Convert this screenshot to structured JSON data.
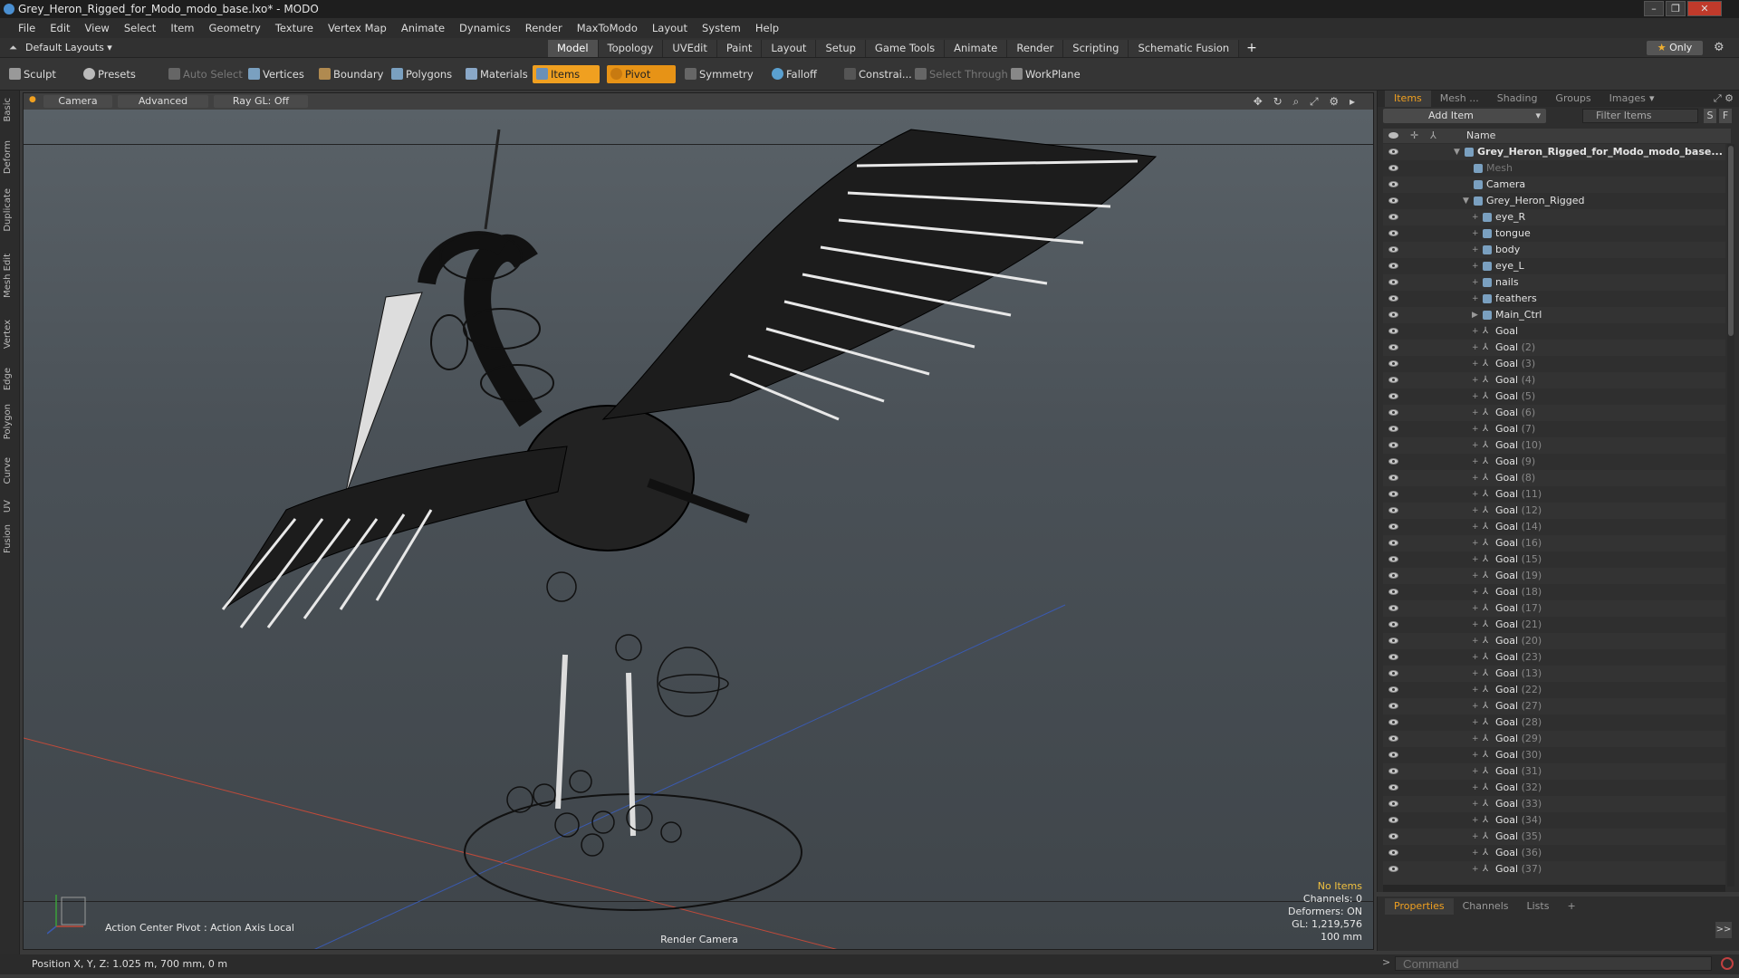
{
  "window": {
    "title": "Grey_Heron_Rigged_for_Modo_modo_base.lxo* - MODO",
    "min": "–",
    "max": "❐",
    "close": "✕"
  },
  "menu": [
    "File",
    "Edit",
    "View",
    "Select",
    "Item",
    "Geometry",
    "Texture",
    "Vertex Map",
    "Animate",
    "Dynamics",
    "Render",
    "MaxToModo",
    "Layout",
    "System",
    "Help"
  ],
  "layout_selector": "Default Layouts ▾",
  "layout_tabs": [
    "Model",
    "Topology",
    "UVEdit",
    "Paint",
    "Layout",
    "Setup",
    "Game Tools",
    "Animate",
    "Render",
    "Scripting",
    "Schematic Fusion"
  ],
  "active_layout_tab": "Model",
  "add_tab": "+",
  "only_button": {
    "star": "★",
    "label": "Only"
  },
  "toolbar": {
    "sculpt": "Sculpt",
    "presets": "Presets",
    "auto_select": "Auto Select",
    "vertices": "Vertices",
    "boundary": "Boundary",
    "polygons": "Polygons",
    "materials": "Materials",
    "items": "Items",
    "pivot": "Pivot",
    "symmetry": "Symmetry",
    "falloff": "Falloff",
    "constraints": "Constrai...",
    "select_through": "Select Through",
    "workplane": "WorkPlane"
  },
  "left_tabs": [
    "Basic",
    "Deform",
    "Duplicate",
    "Mesh Edit",
    "Vertex",
    "Edge",
    "Polygon",
    "Curve",
    "UV",
    "Fusion"
  ],
  "viewport": {
    "camera": "Camera",
    "advanced": "Advanced",
    "raygl": "Ray GL: Off",
    "icons": "✥ ↻ ⌕ ⤢ ⚙ ▸",
    "stats": {
      "no_items": "No Items",
      "channels": "Channels: 0",
      "deformers": "Deformers: ON",
      "gl": "GL: 1,219,576",
      "scale": "100 mm"
    },
    "action_center": "Action Center Pivot : Action Axis Local",
    "render_camera": "Render Camera"
  },
  "status": "Position X, Y, Z:   1.025 m, 700 mm, 0 m",
  "right_panel": {
    "tabs": [
      "Items",
      "Mesh ...",
      "Shading",
      "Groups",
      "Images"
    ],
    "active_tab": "Items",
    "more": "▾",
    "icons": "⤢ ⚙",
    "add_item": "Add Item",
    "add_item_arrow": "▾",
    "filter_items": "Filter Items",
    "s": "S",
    "f": "F",
    "name_header": "Name",
    "rows": [
      {
        "name": "Grey_Heron_Rigged_for_Modo_modo_base...",
        "num": "",
        "indent": 0,
        "bold": true,
        "dim": false,
        "toggle": "▼"
      },
      {
        "name": "Mesh",
        "num": "",
        "indent": 1,
        "bold": false,
        "dim": true,
        "toggle": ""
      },
      {
        "name": "Camera",
        "num": "",
        "indent": 1,
        "bold": false,
        "dim": false,
        "toggle": ""
      },
      {
        "name": "Grey_Heron_Rigged",
        "num": "",
        "indent": 1,
        "bold": false,
        "dim": false,
        "toggle": "▼"
      },
      {
        "name": "eye_R",
        "num": "",
        "indent": 2,
        "bold": false,
        "dim": false,
        "toggle": "+"
      },
      {
        "name": "tongue",
        "num": "",
        "indent": 2,
        "bold": false,
        "dim": false,
        "toggle": "+"
      },
      {
        "name": "body",
        "num": "",
        "indent": 2,
        "bold": false,
        "dim": false,
        "toggle": "+"
      },
      {
        "name": "eye_L",
        "num": "",
        "indent": 2,
        "bold": false,
        "dim": false,
        "toggle": "+"
      },
      {
        "name": "nails",
        "num": "",
        "indent": 2,
        "bold": false,
        "dim": false,
        "toggle": "+"
      },
      {
        "name": "feathers",
        "num": "",
        "indent": 2,
        "bold": false,
        "dim": false,
        "toggle": "+"
      },
      {
        "name": "Main_Ctrl",
        "num": "",
        "indent": 2,
        "bold": false,
        "dim": false,
        "toggle": "▶"
      },
      {
        "name": "Goal",
        "num": "",
        "indent": 2,
        "bold": false,
        "dim": false,
        "toggle": "+",
        "loc": true
      },
      {
        "name": "Goal",
        "num": "(2)",
        "indent": 2,
        "bold": false,
        "dim": false,
        "toggle": "+",
        "loc": true
      },
      {
        "name": "Goal",
        "num": "(3)",
        "indent": 2,
        "bold": false,
        "dim": false,
        "toggle": "+",
        "loc": true
      },
      {
        "name": "Goal",
        "num": "(4)",
        "indent": 2,
        "bold": false,
        "dim": false,
        "toggle": "+",
        "loc": true
      },
      {
        "name": "Goal",
        "num": "(5)",
        "indent": 2,
        "bold": false,
        "dim": false,
        "toggle": "+",
        "loc": true
      },
      {
        "name": "Goal",
        "num": "(6)",
        "indent": 2,
        "bold": false,
        "dim": false,
        "toggle": "+",
        "loc": true
      },
      {
        "name": "Goal",
        "num": "(7)",
        "indent": 2,
        "bold": false,
        "dim": false,
        "toggle": "+",
        "loc": true
      },
      {
        "name": "Goal",
        "num": "(10)",
        "indent": 2,
        "bold": false,
        "dim": false,
        "toggle": "+",
        "loc": true
      },
      {
        "name": "Goal",
        "num": "(9)",
        "indent": 2,
        "bold": false,
        "dim": false,
        "toggle": "+",
        "loc": true
      },
      {
        "name": "Goal",
        "num": "(8)",
        "indent": 2,
        "bold": false,
        "dim": false,
        "toggle": "+",
        "loc": true
      },
      {
        "name": "Goal",
        "num": "(11)",
        "indent": 2,
        "bold": false,
        "dim": false,
        "toggle": "+",
        "loc": true
      },
      {
        "name": "Goal",
        "num": "(12)",
        "indent": 2,
        "bold": false,
        "dim": false,
        "toggle": "+",
        "loc": true
      },
      {
        "name": "Goal",
        "num": "(14)",
        "indent": 2,
        "bold": false,
        "dim": false,
        "toggle": "+",
        "loc": true
      },
      {
        "name": "Goal",
        "num": "(16)",
        "indent": 2,
        "bold": false,
        "dim": false,
        "toggle": "+",
        "loc": true
      },
      {
        "name": "Goal",
        "num": "(15)",
        "indent": 2,
        "bold": false,
        "dim": false,
        "toggle": "+",
        "loc": true
      },
      {
        "name": "Goal",
        "num": "(19)",
        "indent": 2,
        "bold": false,
        "dim": false,
        "toggle": "+",
        "loc": true
      },
      {
        "name": "Goal",
        "num": "(18)",
        "indent": 2,
        "bold": false,
        "dim": false,
        "toggle": "+",
        "loc": true
      },
      {
        "name": "Goal",
        "num": "(17)",
        "indent": 2,
        "bold": false,
        "dim": false,
        "toggle": "+",
        "loc": true
      },
      {
        "name": "Goal",
        "num": "(21)",
        "indent": 2,
        "bold": false,
        "dim": false,
        "toggle": "+",
        "loc": true
      },
      {
        "name": "Goal",
        "num": "(20)",
        "indent": 2,
        "bold": false,
        "dim": false,
        "toggle": "+",
        "loc": true
      },
      {
        "name": "Goal",
        "num": "(23)",
        "indent": 2,
        "bold": false,
        "dim": false,
        "toggle": "+",
        "loc": true
      },
      {
        "name": "Goal",
        "num": "(13)",
        "indent": 2,
        "bold": false,
        "dim": false,
        "toggle": "+",
        "loc": true
      },
      {
        "name": "Goal",
        "num": "(22)",
        "indent": 2,
        "bold": false,
        "dim": false,
        "toggle": "+",
        "loc": true
      },
      {
        "name": "Goal",
        "num": "(27)",
        "indent": 2,
        "bold": false,
        "dim": false,
        "toggle": "+",
        "loc": true
      },
      {
        "name": "Goal",
        "num": "(28)",
        "indent": 2,
        "bold": false,
        "dim": false,
        "toggle": "+",
        "loc": true
      },
      {
        "name": "Goal",
        "num": "(29)",
        "indent": 2,
        "bold": false,
        "dim": false,
        "toggle": "+",
        "loc": true
      },
      {
        "name": "Goal",
        "num": "(30)",
        "indent": 2,
        "bold": false,
        "dim": false,
        "toggle": "+",
        "loc": true
      },
      {
        "name": "Goal",
        "num": "(31)",
        "indent": 2,
        "bold": false,
        "dim": false,
        "toggle": "+",
        "loc": true
      },
      {
        "name": "Goal",
        "num": "(32)",
        "indent": 2,
        "bold": false,
        "dim": false,
        "toggle": "+",
        "loc": true
      },
      {
        "name": "Goal",
        "num": "(33)",
        "indent": 2,
        "bold": false,
        "dim": false,
        "toggle": "+",
        "loc": true
      },
      {
        "name": "Goal",
        "num": "(34)",
        "indent": 2,
        "bold": false,
        "dim": false,
        "toggle": "+",
        "loc": true
      },
      {
        "name": "Goal",
        "num": "(35)",
        "indent": 2,
        "bold": false,
        "dim": false,
        "toggle": "+",
        "loc": true
      },
      {
        "name": "Goal",
        "num": "(36)",
        "indent": 2,
        "bold": false,
        "dim": false,
        "toggle": "+",
        "loc": true
      },
      {
        "name": "Goal",
        "num": "(37)",
        "indent": 2,
        "bold": false,
        "dim": false,
        "toggle": "+",
        "loc": true
      }
    ]
  },
  "properties_tabs": [
    "Properties",
    "Channels",
    "Lists",
    "+"
  ],
  "properties_active": "Properties",
  "properties_arrow": ">>",
  "command": {
    "prompt": ">",
    "placeholder": "Command"
  },
  "colors": {
    "accent": "#f0a020",
    "grid_x": "#c04a3a",
    "grid_z": "#3a5ab0"
  }
}
